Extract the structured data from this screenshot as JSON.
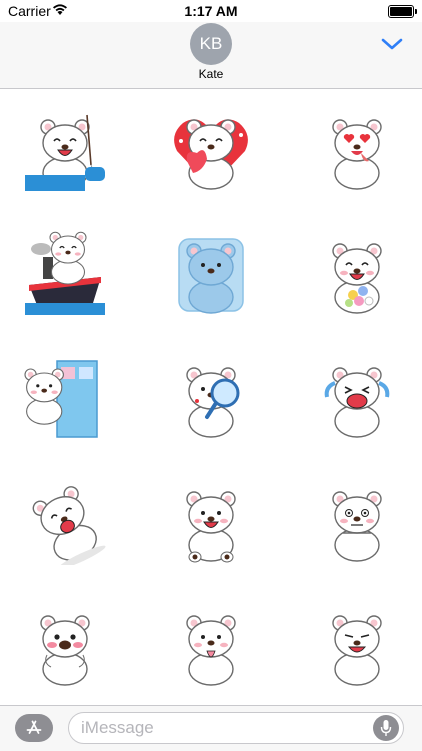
{
  "status_bar": {
    "carrier": "Carrier",
    "time": "1:17 AM",
    "battery_level": 1.0
  },
  "header": {
    "avatar_initials": "KB",
    "contact_name": "Kate",
    "collapse_icon": "chevron-down-icon",
    "accent_color": "#2f7ff7"
  },
  "stickers": [
    {
      "name": "bear-fishing"
    },
    {
      "name": "bear-heart-frame"
    },
    {
      "name": "bear-heart-eyes"
    },
    {
      "name": "bear-on-ship"
    },
    {
      "name": "bear-frozen-ice"
    },
    {
      "name": "bear-flower-bouquet"
    },
    {
      "name": "bear-door-peek"
    },
    {
      "name": "bear-magnifying-glass"
    },
    {
      "name": "bear-crying"
    },
    {
      "name": "bear-rolling"
    },
    {
      "name": "bear-sitting-smile"
    },
    {
      "name": "bear-nervous"
    },
    {
      "name": "bear-blushing"
    },
    {
      "name": "bear-tongue-out"
    },
    {
      "name": "bear-grinning"
    }
  ],
  "input_bar": {
    "placeholder": "iMessage",
    "app_store_icon": "app-store-icon",
    "mic_icon": "microphone-icon"
  }
}
